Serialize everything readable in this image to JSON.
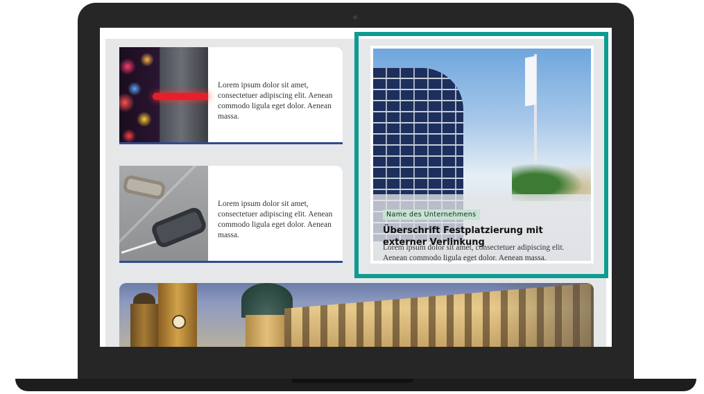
{
  "cards": [
    {
      "text": "Lorem ipsum dolor sit amet, consectetuer adipiscing elit. Aenean commodo ligula eget dolor. Aenean massa.",
      "image": "car-rear-lights"
    },
    {
      "text": "Lorem ipsum dolor sit amet, consectetuer adipiscing elit. Aenean commodo ligula eget dolor. Aenean massa.",
      "image": "cars-parking-aerial"
    }
  ],
  "featured": {
    "badge": "Name des Unternehmens",
    "title": "Überschrift Festplatzierung mit externer Verlinkung",
    "text": "Lorem ipsum dolor sit amet, consectetuer adipiscing elit. Aenean commodo ligula eget dolor. Aenean massa.",
    "image": "office-building-with-flag",
    "highlight_color": "#0e9b91"
  },
  "banner": {
    "image": "munich-theatinerkirche"
  },
  "colors": {
    "card_border": "#2f4a8e",
    "page_bg": "#e6e7e9",
    "badge_bg": "#c6e3d4"
  }
}
